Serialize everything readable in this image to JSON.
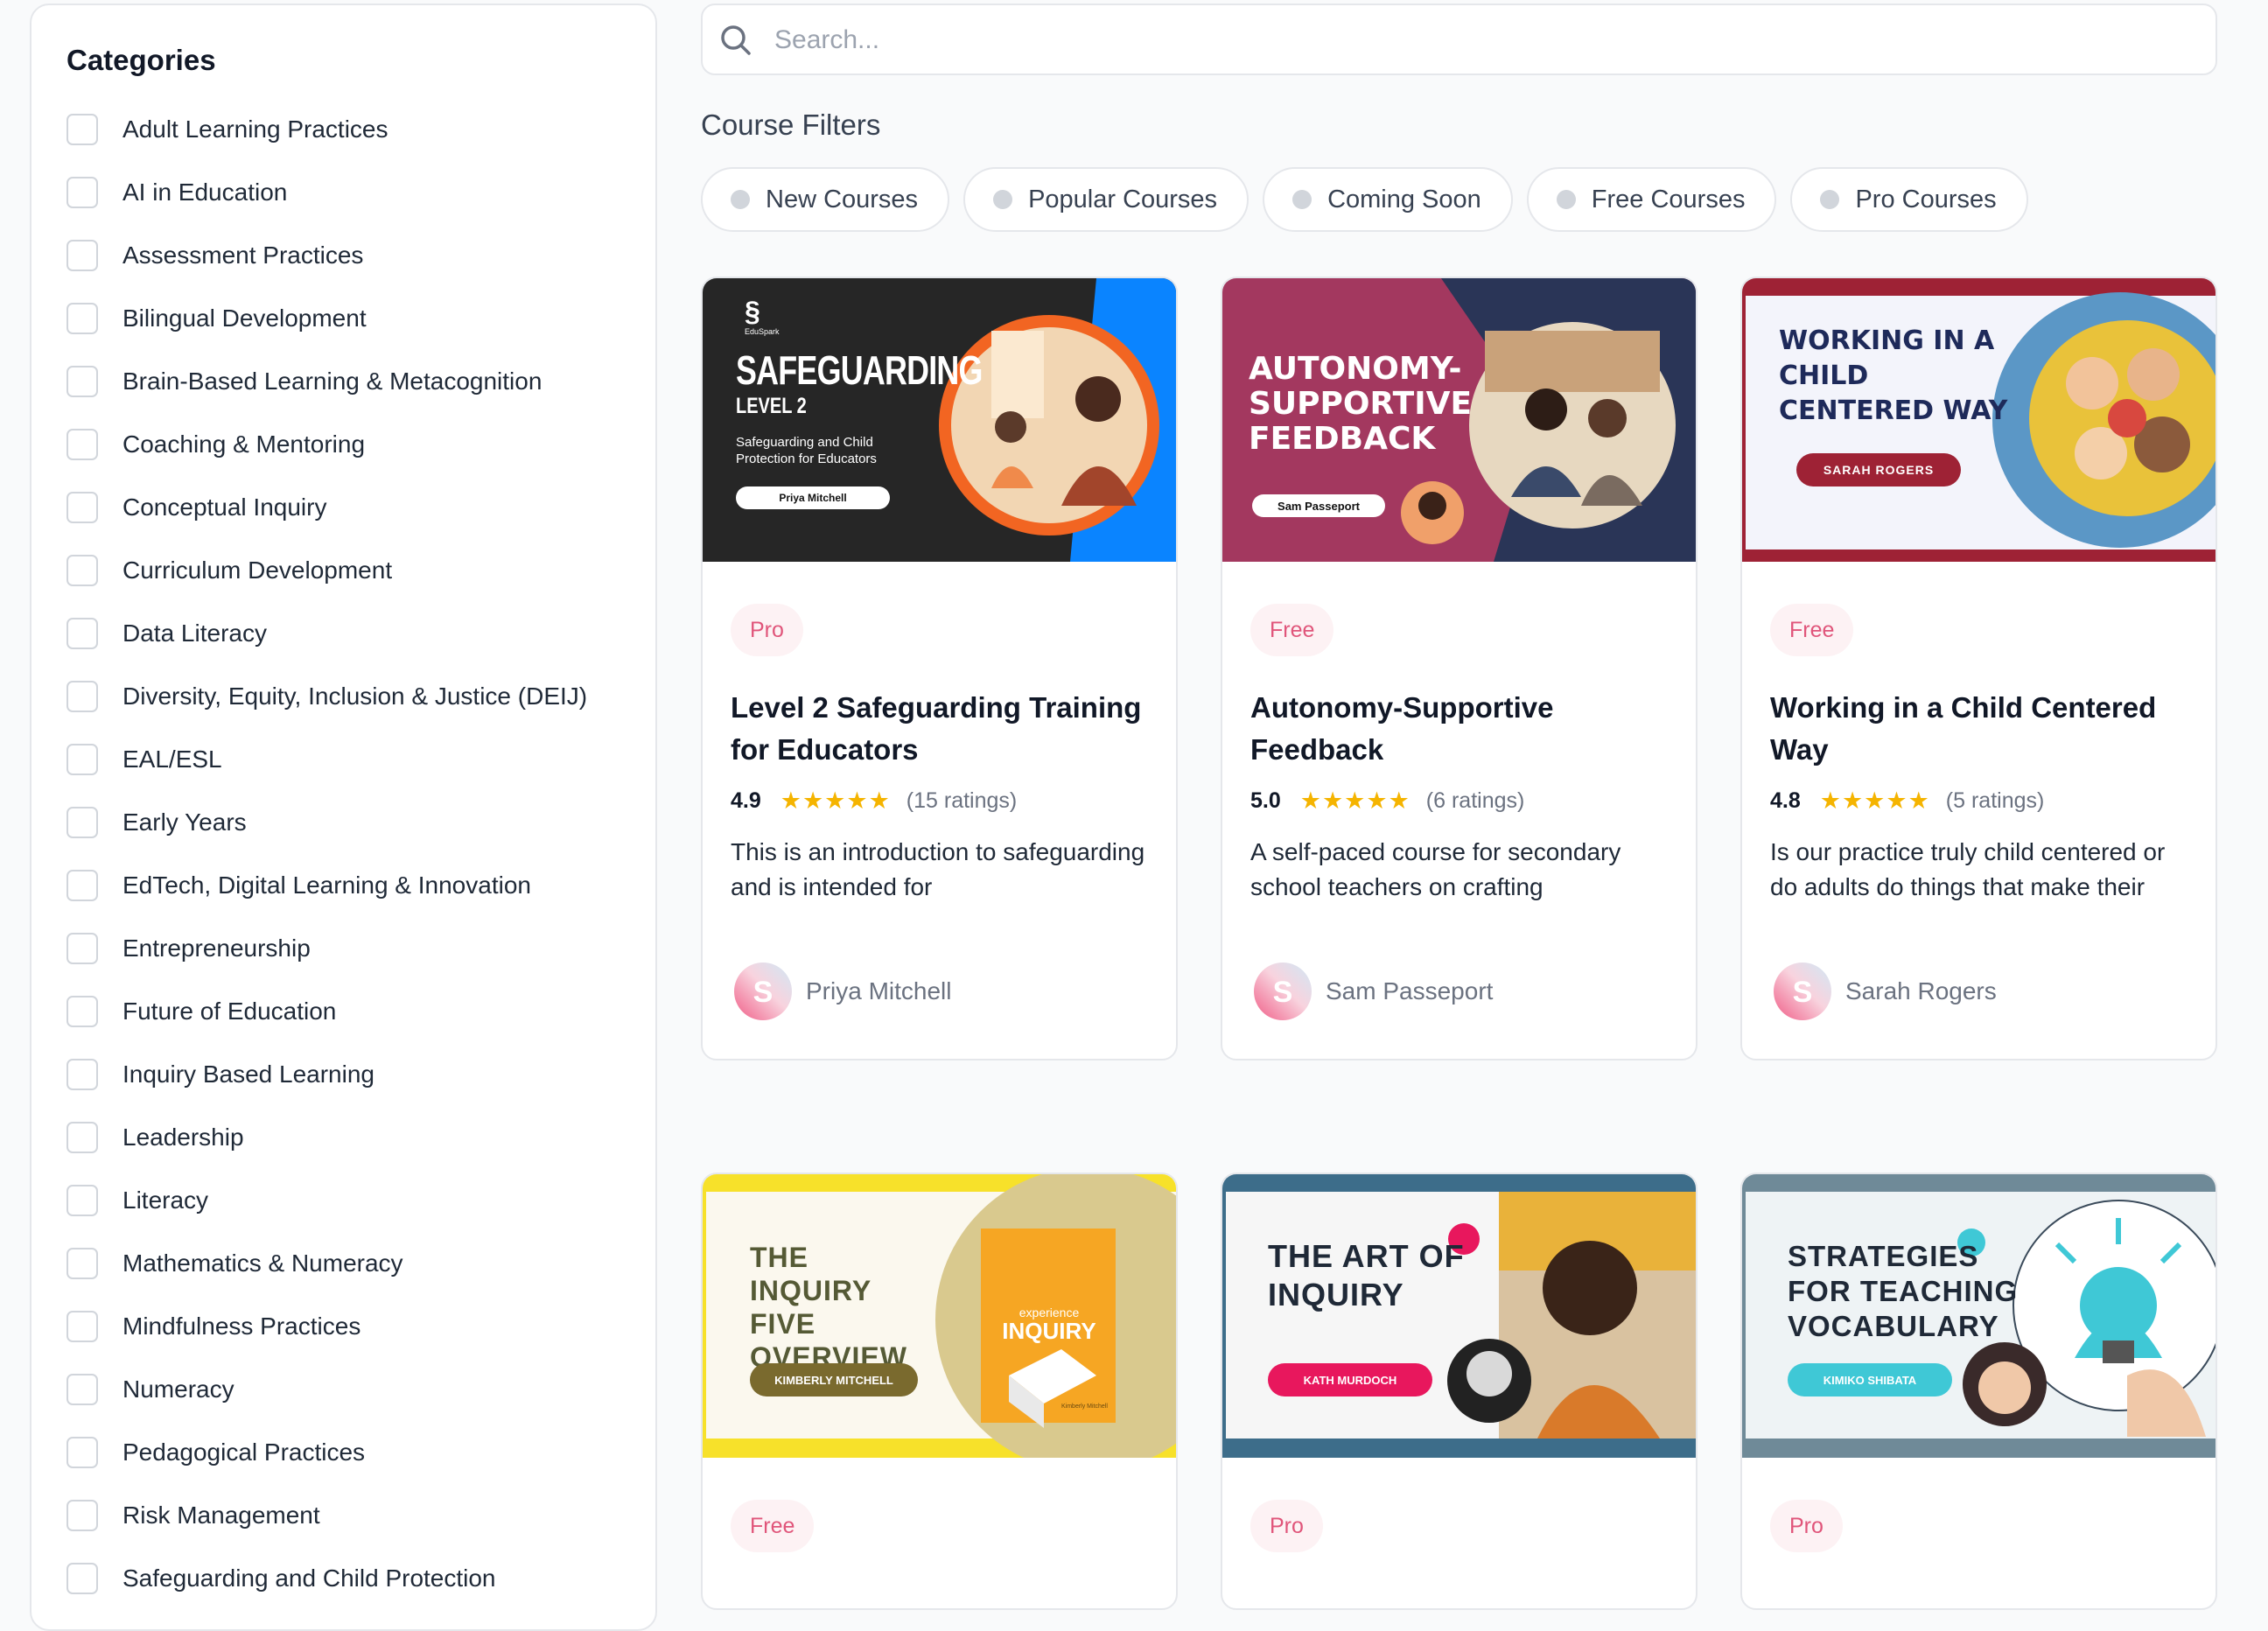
{
  "sidebar": {
    "title": "Categories",
    "items": [
      {
        "label": "Adult Learning Practices"
      },
      {
        "label": "AI in Education"
      },
      {
        "label": "Assessment Practices"
      },
      {
        "label": "Bilingual Development"
      },
      {
        "label": "Brain-Based Learning & Metacognition"
      },
      {
        "label": "Coaching & Mentoring"
      },
      {
        "label": "Conceptual Inquiry"
      },
      {
        "label": "Curriculum Development"
      },
      {
        "label": "Data Literacy"
      },
      {
        "label": "Diversity, Equity, Inclusion & Justice (DEIJ)"
      },
      {
        "label": "EAL/ESL"
      },
      {
        "label": "Early Years"
      },
      {
        "label": "EdTech, Digital Learning & Innovation"
      },
      {
        "label": "Entrepreneurship"
      },
      {
        "label": "Future of Education"
      },
      {
        "label": "Inquiry Based Learning"
      },
      {
        "label": "Leadership"
      },
      {
        "label": "Literacy"
      },
      {
        "label": "Mathematics & Numeracy"
      },
      {
        "label": "Mindfulness Practices"
      },
      {
        "label": "Numeracy"
      },
      {
        "label": "Pedagogical Practices"
      },
      {
        "label": "Risk Management"
      },
      {
        "label": "Safeguarding and Child Protection"
      }
    ]
  },
  "search": {
    "placeholder": "Search..."
  },
  "filters": {
    "title": "Course Filters",
    "chips": [
      {
        "label": "New Courses"
      },
      {
        "label": "Popular Courses"
      },
      {
        "label": "Coming Soon"
      },
      {
        "label": "Free Courses"
      },
      {
        "label": "Pro Courses"
      }
    ]
  },
  "courses": [
    {
      "badge": "Pro",
      "title": "Level 2 Safeguarding Training for Educators",
      "rating": "4.9",
      "stars": "★★★★★",
      "ratings_count": "(15 ratings)",
      "description": "This is an introduction to safeguarding and is intended for",
      "author": "Priya Mitchell",
      "thumb": {
        "heading": "SAFEGUARDING",
        "subheading": "LEVEL 2",
        "caption": "Safeguarding and Child Protection for Educators",
        "tag": "Priya Mitchell",
        "brand": "EduSpark"
      }
    },
    {
      "badge": "Free",
      "title": "Autonomy-Supportive Feedback",
      "rating": "5.0",
      "stars": "★★★★★",
      "ratings_count": "(6 ratings)",
      "description": "A self-paced course for secondary school teachers on crafting",
      "author": "Sam Passeport",
      "thumb": {
        "line1": "AUTONOMY-",
        "line2": "SUPPORTIVE",
        "line3": "FEEDBACK",
        "tag": "Sam Passeport"
      }
    },
    {
      "badge": "Free",
      "title": "Working in a Child Centered Way",
      "rating": "4.8",
      "stars": "★★★★★",
      "ratings_count": "(5 ratings)",
      "description": "Is our practice truly child centered or do adults do things that make their",
      "author": "Sarah Rogers",
      "thumb": {
        "line1": "WORKING IN A",
        "line2": "CHILD",
        "line3": "CENTERED WAY",
        "tag": "SARAH ROGERS"
      }
    },
    {
      "badge": "Free",
      "thumb": {
        "line1": "THE",
        "line2": "INQUIRY",
        "line3": "FIVE",
        "line4": "OVERVIEW",
        "tag": "KIMBERLY MITCHELL",
        "book_small": "experience",
        "book_title": "INQUIRY",
        "book_author": "Kimberly Mitchell"
      }
    },
    {
      "badge": "Pro",
      "thumb": {
        "line1": "THE ART OF",
        "line2": "INQUIRY",
        "tag": "KATH MURDOCH"
      }
    },
    {
      "badge": "Pro",
      "thumb": {
        "line1": "STRATEGIES",
        "line2": "FOR TEACHING",
        "line3": "VOCABULARY",
        "tag": "KIMIKO SHIBATA"
      }
    }
  ],
  "colors": {
    "badge_text": "#e0557a",
    "badge_bg": "#fdf2f4",
    "star": "#f5b400",
    "thumb1_bg": "#262626",
    "thumb1_accent": "#f26522",
    "thumb2_bg": "#a3385f",
    "thumb3_border": "#9e2235",
    "thumb4_yellow": "#f7e12a",
    "thumb5_pink": "#e8175d",
    "thumb6_cyan": "#3fc8d6"
  }
}
